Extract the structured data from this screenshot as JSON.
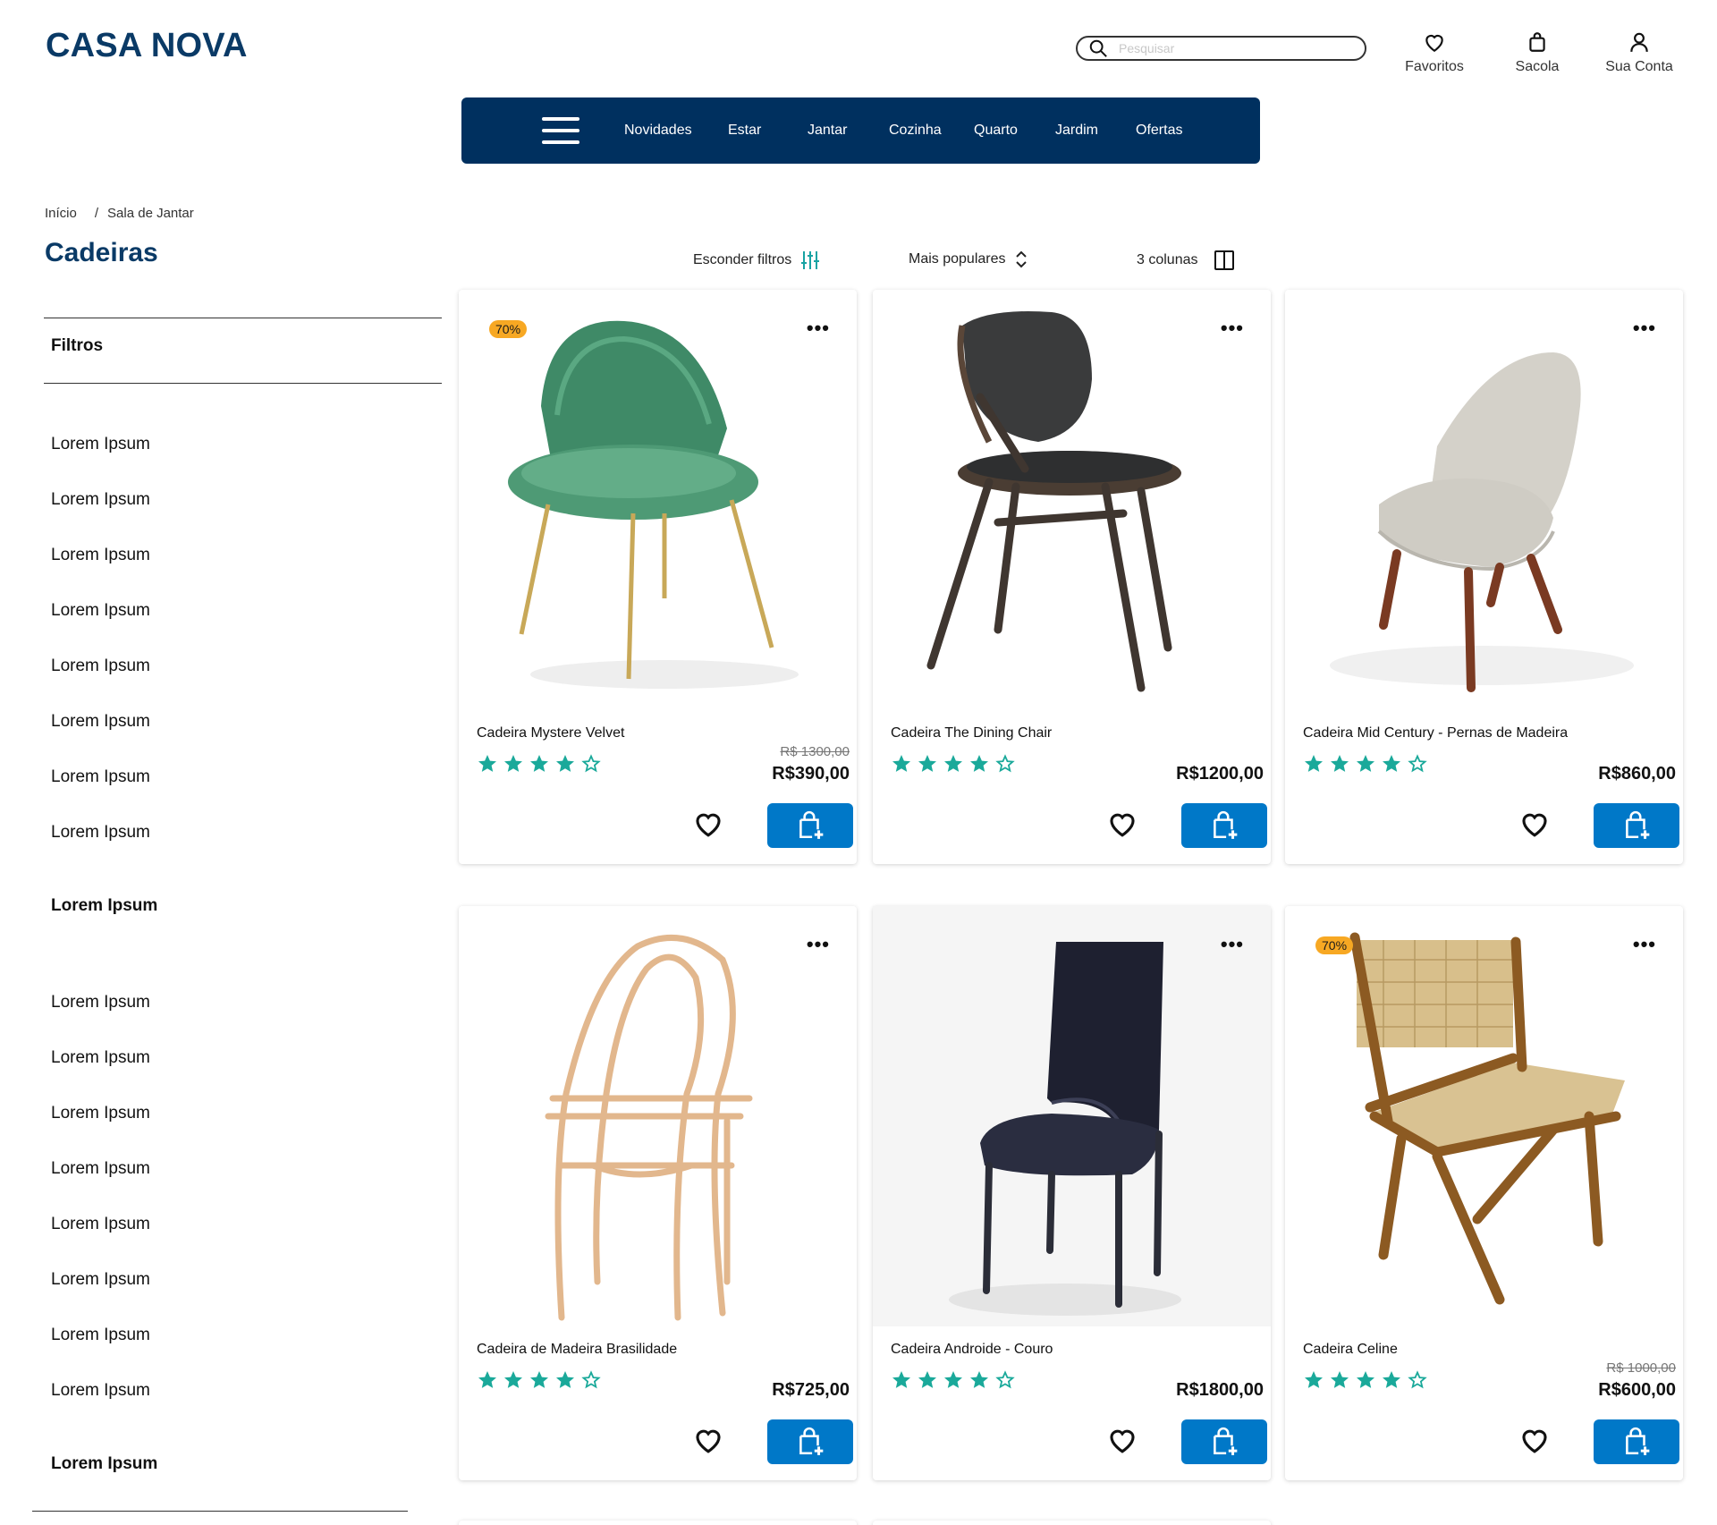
{
  "header": {
    "logo": "CASA NOVA",
    "search_placeholder": "Pesquisar",
    "actions": {
      "favorites": "Favoritos",
      "bag": "Sacola",
      "account": "Sua Conta"
    }
  },
  "nav": {
    "items": [
      "Novidades",
      "Estar",
      "Jantar",
      "Cozinha",
      "Quarto",
      "Jardim",
      "Ofertas"
    ]
  },
  "breadcrumb": {
    "home": "Início",
    "separator": "/",
    "current": "Sala de Jantar"
  },
  "page_title": "Cadeiras",
  "sidebar": {
    "filters_title": "Filtros",
    "group1": [
      "Lorem Ipsum",
      "Lorem Ipsum",
      "Lorem Ipsum",
      "Lorem Ipsum",
      "Lorem Ipsum",
      "Lorem Ipsum",
      "Lorem Ipsum",
      "Lorem Ipsum"
    ],
    "group1_heading": "Lorem Ipsum",
    "group2": [
      "Lorem Ipsum",
      "Lorem Ipsum",
      "Lorem Ipsum",
      "Lorem Ipsum",
      "Lorem Ipsum",
      "Lorem Ipsum",
      "Lorem Ipsum",
      "Lorem Ipsum"
    ],
    "group2_heading": "Lorem Ipsum"
  },
  "toolbar": {
    "hide_filters": "Esconder filtros",
    "sort": "Mais populares",
    "columns": "3 colunas"
  },
  "colors": {
    "brand": "#0a3a66",
    "nav": "#00305f",
    "cta": "#0078c8",
    "star": "#1aa99a",
    "badge": "#f7a823"
  },
  "products": [
    {
      "name": "Cadeira Mystere Velvet",
      "badge": "70%",
      "old_price": "R$ 1300,00",
      "price": "R$390,00",
      "rating": 4,
      "max_rating": 5
    },
    {
      "name": "Cadeira The Dining Chair",
      "badge": "",
      "old_price": "",
      "price": "R$1200,00",
      "rating": 4,
      "max_rating": 5
    },
    {
      "name": "Cadeira Mid Century - Pernas de Madeira",
      "badge": "",
      "old_price": "",
      "price": "R$860,00",
      "rating": 4,
      "max_rating": 5
    },
    {
      "name": "Cadeira de Madeira Brasilidade",
      "badge": "",
      "old_price": "",
      "price": "R$725,00",
      "rating": 4,
      "max_rating": 5
    },
    {
      "name": "Cadeira Androide - Couro",
      "badge": "",
      "old_price": "",
      "price": "R$1800,00",
      "rating": 4,
      "max_rating": 5
    },
    {
      "name": "Cadeira Celine",
      "badge": "70%",
      "old_price": "R$ 1000,00",
      "price": "R$600,00",
      "rating": 4,
      "max_rating": 5
    }
  ]
}
